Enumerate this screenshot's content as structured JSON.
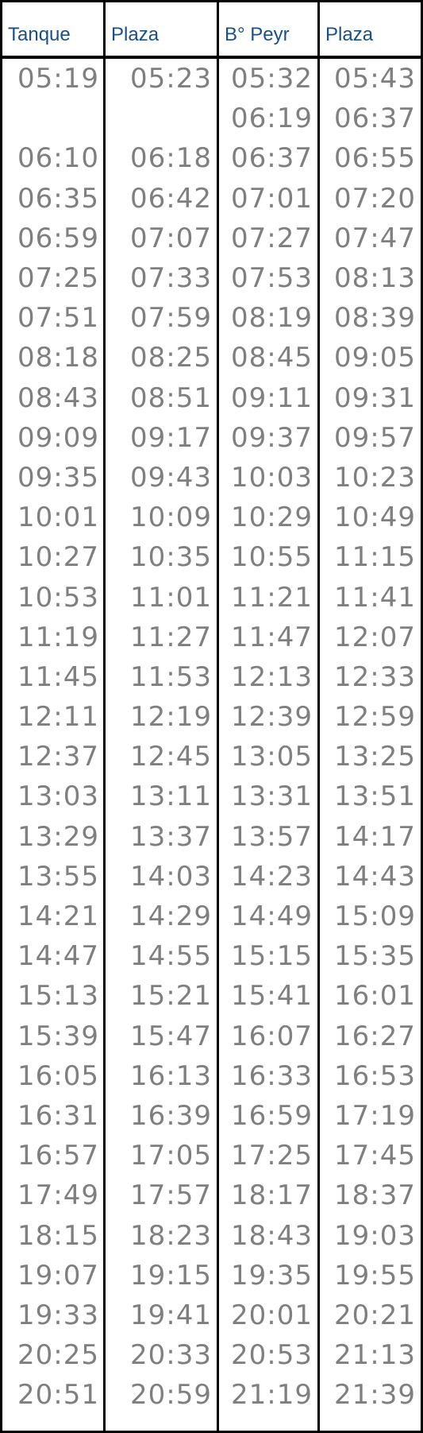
{
  "headers": [
    "Tanque",
    "Plaza",
    "B° Peyr",
    "Plaza"
  ],
  "rows": [
    [
      "05:19",
      "05:23",
      "05:32",
      "05:43"
    ],
    [
      "",
      "",
      "06:19",
      "06:37"
    ],
    [
      "06:10",
      "06:18",
      "06:37",
      "06:55"
    ],
    [
      "06:35",
      "06:42",
      "07:01",
      "07:20"
    ],
    [
      "06:59",
      "07:07",
      "07:27",
      "07:47"
    ],
    [
      "07:25",
      "07:33",
      "07:53",
      "08:13"
    ],
    [
      "07:51",
      "07:59",
      "08:19",
      "08:39"
    ],
    [
      "08:18",
      "08:25",
      "08:45",
      "09:05"
    ],
    [
      "08:43",
      "08:51",
      "09:11",
      "09:31"
    ],
    [
      "09:09",
      "09:17",
      "09:37",
      "09:57"
    ],
    [
      "09:35",
      "09:43",
      "10:03",
      "10:23"
    ],
    [
      "10:01",
      "10:09",
      "10:29",
      "10:49"
    ],
    [
      "10:27",
      "10:35",
      "10:55",
      "11:15"
    ],
    [
      "10:53",
      "11:01",
      "11:21",
      "11:41"
    ],
    [
      "11:19",
      "11:27",
      "11:47",
      "12:07"
    ],
    [
      "11:45",
      "11:53",
      "12:13",
      "12:33"
    ],
    [
      "12:11",
      "12:19",
      "12:39",
      "12:59"
    ],
    [
      "12:37",
      "12:45",
      "13:05",
      "13:25"
    ],
    [
      "13:03",
      "13:11",
      "13:31",
      "13:51"
    ],
    [
      "13:29",
      "13:37",
      "13:57",
      "14:17"
    ],
    [
      "13:55",
      "14:03",
      "14:23",
      "14:43"
    ],
    [
      "14:21",
      "14:29",
      "14:49",
      "15:09"
    ],
    [
      "14:47",
      "14:55",
      "15:15",
      "15:35"
    ],
    [
      "15:13",
      "15:21",
      "15:41",
      "16:01"
    ],
    [
      "15:39",
      "15:47",
      "16:07",
      "16:27"
    ],
    [
      "16:05",
      "16:13",
      "16:33",
      "16:53"
    ],
    [
      "16:31",
      "16:39",
      "16:59",
      "17:19"
    ],
    [
      "16:57",
      "17:05",
      "17:25",
      "17:45"
    ],
    [
      "17:49",
      "17:57",
      "18:17",
      "18:37"
    ],
    [
      "18:15",
      "18:23",
      "18:43",
      "19:03"
    ],
    [
      "19:07",
      "19:15",
      "19:35",
      "19:55"
    ],
    [
      "19:33",
      "19:41",
      "20:01",
      "20:21"
    ],
    [
      "20:25",
      "20:33",
      "20:53",
      "21:13"
    ],
    [
      "20:51",
      "20:59",
      "21:19",
      "21:39"
    ]
  ],
  "colors": {
    "header_text": "#1a4f8a",
    "time_text": "#7f7f7f",
    "border": "#000000"
  }
}
